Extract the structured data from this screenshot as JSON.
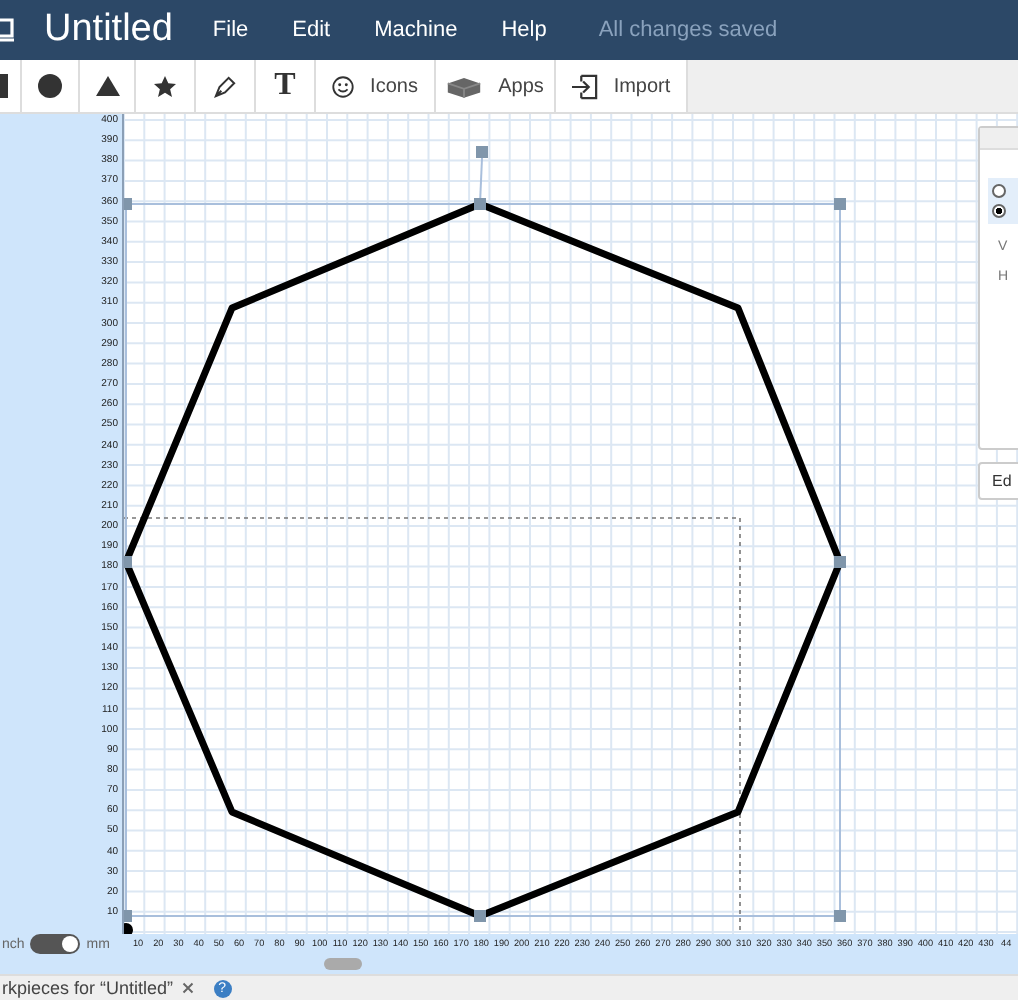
{
  "header": {
    "title": "Untitled",
    "menus": [
      "File",
      "Edit",
      "Machine",
      "Help"
    ],
    "status": "All changes saved"
  },
  "toolbar": [
    {
      "kind": "square"
    },
    {
      "kind": "circle"
    },
    {
      "kind": "triangle"
    },
    {
      "kind": "star"
    },
    {
      "kind": "pen"
    },
    {
      "kind": "text",
      "label": "T"
    },
    {
      "kind": "icons",
      "label": "Icons"
    },
    {
      "kind": "apps",
      "label": "Apps"
    },
    {
      "kind": "import",
      "label": "Import"
    }
  ],
  "vertical_ruler": [
    "400",
    "390",
    "380",
    "370",
    "360",
    "350",
    "340",
    "330",
    "320",
    "310",
    "300",
    "290",
    "280",
    "270",
    "260",
    "250",
    "240",
    "230",
    "220",
    "210",
    "200",
    "190",
    "180",
    "170",
    "160",
    "150",
    "140",
    "130",
    "120",
    "110",
    "100",
    "90",
    "80",
    "70",
    "60",
    "50",
    "40",
    "30",
    "20",
    "10"
  ],
  "horizontal_ruler": [
    "10",
    "20",
    "30",
    "40",
    "50",
    "60",
    "70",
    "80",
    "90",
    "100",
    "110",
    "120",
    "130",
    "140",
    "150",
    "160",
    "170",
    "180",
    "190",
    "200",
    "210",
    "220",
    "230",
    "240",
    "250",
    "260",
    "270",
    "280",
    "290",
    "300",
    "310",
    "320",
    "330",
    "340",
    "350",
    "360",
    "370",
    "380",
    "390",
    "400",
    "410",
    "420",
    "430",
    "44"
  ],
  "unit_toggle": {
    "left_label": "nch",
    "right_label": "mm",
    "on": true
  },
  "side_panel": {
    "radios": [
      {
        "selected": false
      },
      {
        "selected": true
      }
    ],
    "labels": [
      "V",
      "H"
    ],
    "edit_label": "Ed"
  },
  "status_bar": {
    "text": "rkpieces for “Untitled”",
    "help": "?"
  }
}
